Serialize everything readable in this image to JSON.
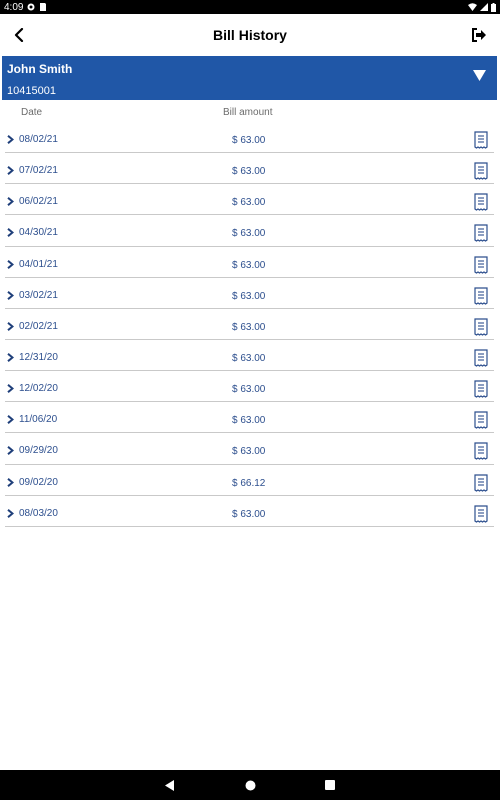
{
  "status_bar": {
    "time": "4:09"
  },
  "app_bar": {
    "title": "Bill History"
  },
  "account": {
    "name": "John Smith",
    "number": "10415001"
  },
  "table": {
    "headers": {
      "date": "Date",
      "amount": "Bill amount"
    },
    "rows": [
      {
        "date": "08/02/21",
        "amount": "$ 63.00"
      },
      {
        "date": "07/02/21",
        "amount": "$ 63.00"
      },
      {
        "date": "06/02/21",
        "amount": "$ 63.00"
      },
      {
        "date": "04/30/21",
        "amount": "$ 63.00"
      },
      {
        "date": "04/01/21",
        "amount": "$ 63.00"
      },
      {
        "date": "03/02/21",
        "amount": "$ 63.00"
      },
      {
        "date": "02/02/21",
        "amount": "$ 63.00"
      },
      {
        "date": "12/31/20",
        "amount": "$ 63.00"
      },
      {
        "date": "12/02/20",
        "amount": "$ 63.00"
      },
      {
        "date": "11/06/20",
        "amount": "$ 63.00"
      },
      {
        "date": "09/29/20",
        "amount": "$ 63.00"
      },
      {
        "date": "09/02/20",
        "amount": "$ 66.12"
      },
      {
        "date": "08/03/20",
        "amount": "$ 63.00"
      }
    ]
  },
  "colors": {
    "accent": "#2057a7",
    "text_link": "#2d4f8e",
    "divider": "#c9c9c9"
  },
  "icons": {
    "back": "back-arrow-icon",
    "logout": "logout-icon",
    "dropdown": "triangle-down-icon",
    "row_chevron": "chevron-right-icon",
    "bill": "receipt-icon"
  }
}
